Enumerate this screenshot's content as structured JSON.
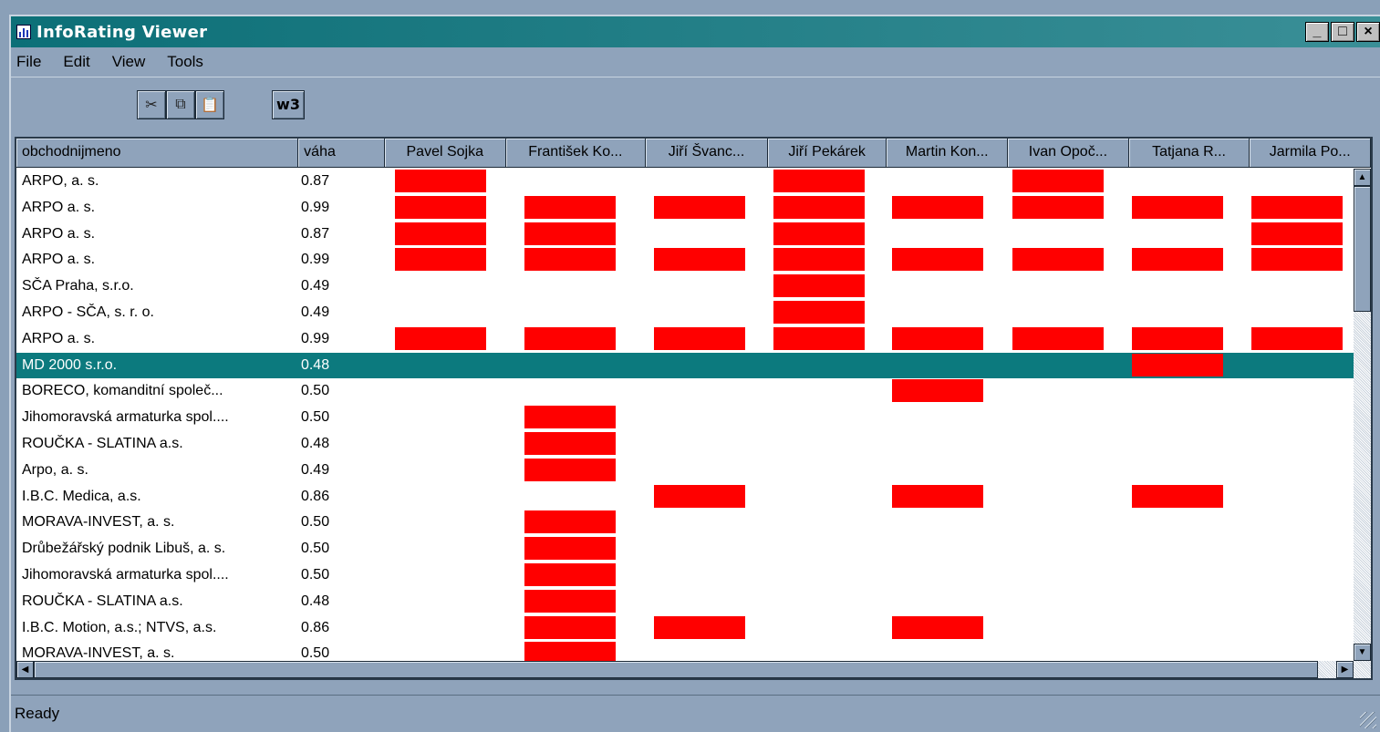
{
  "window": {
    "title": "InfoRating Viewer"
  },
  "menu": [
    "File",
    "Edit",
    "View",
    "Tools"
  ],
  "toolbar": {
    "w3_label": "w3"
  },
  "grid": {
    "columns": [
      "obchodnijmeno",
      "váha",
      "Pavel Sojka",
      "František Ko...",
      "Jiří Švanc...",
      "Jiří Pekárek",
      "Martin Kon...",
      "Ivan Opoč...",
      "Tatjana R...",
      "Jarmila Po..."
    ],
    "rows": [
      {
        "name": "ARPO, a. s.",
        "weight": "0.87",
        "marks": [
          1,
          0,
          0,
          1,
          0,
          1,
          0,
          0
        ]
      },
      {
        "name": "ARPO a. s.",
        "weight": "0.99",
        "marks": [
          1,
          1,
          1,
          1,
          1,
          1,
          1,
          1
        ]
      },
      {
        "name": "ARPO a. s.",
        "weight": "0.87",
        "marks": [
          1,
          1,
          0,
          1,
          0,
          0,
          0,
          1
        ]
      },
      {
        "name": "ARPO a. s.",
        "weight": "0.99",
        "marks": [
          1,
          1,
          1,
          1,
          1,
          1,
          1,
          1
        ]
      },
      {
        "name": "SČA Praha, s.r.o.",
        "weight": "0.49",
        "marks": [
          0,
          0,
          0,
          1,
          0,
          0,
          0,
          0
        ]
      },
      {
        "name": "ARPO - SČA, s. r. o.",
        "weight": "0.49",
        "marks": [
          0,
          0,
          0,
          1,
          0,
          0,
          0,
          0
        ]
      },
      {
        "name": "ARPO a. s.",
        "weight": "0.99",
        "marks": [
          1,
          1,
          1,
          1,
          1,
          1,
          1,
          1
        ]
      },
      {
        "name": "MD 2000 s.r.o.",
        "weight": "0.48",
        "marks": [
          0,
          0,
          0,
          0,
          0,
          0,
          1,
          0
        ],
        "selected": true
      },
      {
        "name": "BORECO, komanditní společ...",
        "weight": "0.50",
        "marks": [
          0,
          0,
          0,
          0,
          1,
          0,
          0,
          0
        ]
      },
      {
        "name": "Jihomoravská armaturka spol....",
        "weight": "0.50",
        "marks": [
          0,
          1,
          0,
          0,
          0,
          0,
          0,
          0
        ]
      },
      {
        "name": "ROUČKA - SLATINA a.s.",
        "weight": "0.48",
        "marks": [
          0,
          1,
          0,
          0,
          0,
          0,
          0,
          0
        ]
      },
      {
        "name": "Arpo, a. s.",
        "weight": "0.49",
        "marks": [
          0,
          1,
          0,
          0,
          0,
          0,
          0,
          0
        ]
      },
      {
        "name": "I.B.C. Medica, a.s.",
        "weight": "0.86",
        "marks": [
          0,
          0,
          1,
          0,
          1,
          0,
          1,
          0
        ]
      },
      {
        "name": "MORAVA-INVEST, a. s.",
        "weight": "0.50",
        "marks": [
          0,
          1,
          0,
          0,
          0,
          0,
          0,
          0
        ]
      },
      {
        "name": "Drůbežářský podnik Libuš, a. s.",
        "weight": "0.50",
        "marks": [
          0,
          1,
          0,
          0,
          0,
          0,
          0,
          0
        ]
      },
      {
        "name": "Jihomoravská armaturka spol....",
        "weight": "0.50",
        "marks": [
          0,
          1,
          0,
          0,
          0,
          0,
          0,
          0
        ]
      },
      {
        "name": "ROUČKA - SLATINA a.s.",
        "weight": "0.48",
        "marks": [
          0,
          1,
          0,
          0,
          0,
          0,
          0,
          0
        ]
      },
      {
        "name": "I.B.C. Motion, a.s.; NTVS, a.s.",
        "weight": "0.86",
        "marks": [
          0,
          1,
          1,
          0,
          1,
          0,
          0,
          0
        ]
      },
      {
        "name": "MORAVA-INVEST, a. s.",
        "weight": "0.50",
        "marks": [
          0,
          1,
          0,
          0,
          0,
          0,
          0,
          0
        ]
      }
    ],
    "mark_color": "#ff0000",
    "selected_color": "#0c7a7e"
  },
  "status": {
    "text": "Ready"
  }
}
